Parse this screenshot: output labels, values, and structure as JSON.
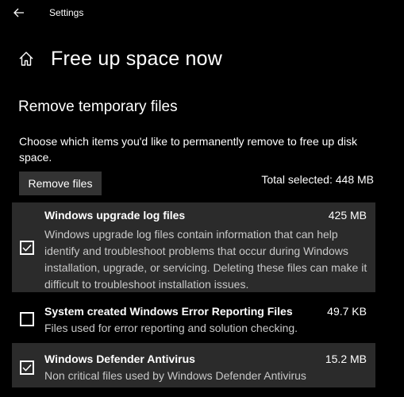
{
  "window": {
    "app_title": "Settings"
  },
  "page": {
    "title": "Free up space now"
  },
  "section": {
    "title": "Remove temporary files",
    "description": "Choose which items you'd like to permanently remove to free up disk space.",
    "remove_button": "Remove files",
    "total_selected": "Total selected: 448 MB"
  },
  "items": [
    {
      "name": "Windows upgrade log files",
      "size": "425 MB",
      "checked": true,
      "description": "Windows upgrade log files contain information that can help identify and troubleshoot problems that occur during Windows installation, upgrade, or servicing.  Deleting these files can make it difficult to troubleshoot installation issues."
    },
    {
      "name": "System created Windows Error Reporting Files",
      "size": "49.7 KB",
      "checked": false,
      "description": "Files used for error reporting and solution checking."
    },
    {
      "name": "Windows Defender Antivirus",
      "size": "15.2 MB",
      "checked": true,
      "description": "Non critical files used by Windows Defender Antivirus"
    }
  ],
  "icons": {
    "back": "back-arrow-icon",
    "home": "home-icon",
    "check": "checkmark-icon"
  },
  "colors": {
    "background": "#000000",
    "selected_item": "#2b2b2b",
    "button": "#333333",
    "secondary_text": "#c8c8c8"
  }
}
